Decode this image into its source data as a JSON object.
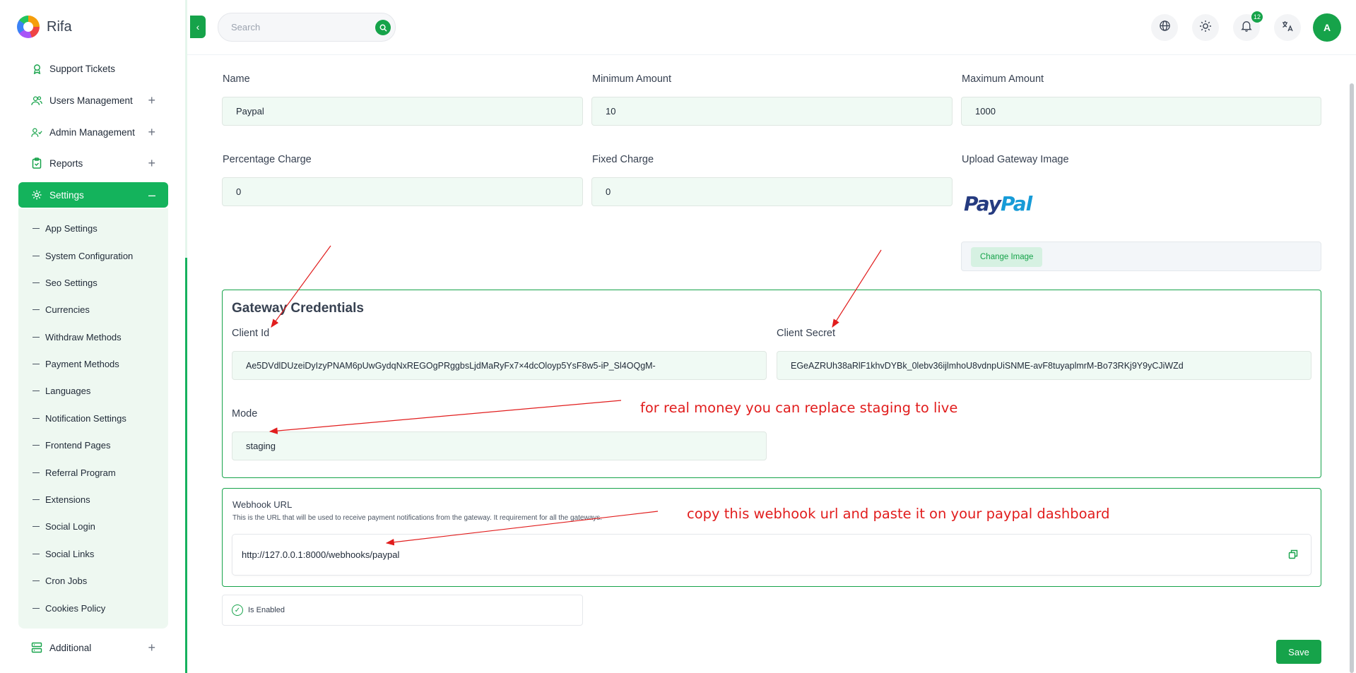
{
  "brand": {
    "name": "Rifa"
  },
  "header": {
    "search_placeholder": "Search",
    "notifications_count": "12",
    "avatar_initial": "A"
  },
  "sidebar": {
    "items": [
      {
        "label": "Support Tickets",
        "icon": "ticket-icon"
      },
      {
        "label": "Users Management",
        "icon": "users-icon"
      },
      {
        "label": "Admin Management",
        "icon": "admin-users-icon"
      },
      {
        "label": "Reports",
        "icon": "clipboard-icon"
      },
      {
        "label": "Settings",
        "icon": "gear-icon"
      },
      {
        "label": "Additional",
        "icon": "server-icon"
      }
    ],
    "settings_sub": [
      "App Settings",
      "System Configuration",
      "Seo Settings",
      "Currencies",
      "Withdraw Methods",
      "Payment Methods",
      "Languages",
      "Notification Settings",
      "Frontend Pages",
      "Referral Program",
      "Extensions",
      "Social Login",
      "Social Links",
      "Cron Jobs",
      "Cookies Policy"
    ]
  },
  "form": {
    "name_label": "Name",
    "name_value": "Paypal",
    "min_label": "Minimum Amount",
    "min_value": "10",
    "max_label": "Maximum Amount",
    "max_value": "1000",
    "pct_label": "Percentage Charge",
    "pct_value": "0",
    "fixed_label": "Fixed Charge",
    "fixed_value": "0",
    "upload_label": "Upload Gateway Image",
    "logo_text_1": "Pay",
    "logo_text_2": "Pal",
    "change_image": "Change Image"
  },
  "credentials": {
    "title": "Gateway Credentials",
    "client_id_label": "Client Id",
    "client_id_value": "Ae5DVdlDUzeiDyIzyPNAM6pUwGydqNxREGOgPRggbsLjdMaRyFx7×4dcOloyp5YsF8w5-iP_Sl4OQgM-",
    "client_secret_label": "Client Secret",
    "client_secret_value": "EGeAZRUh38aRlF1khvDYBk_0lebv36ijlmhoU8vdnpUiSNME-avF8tuyaplmrM-Bo73RKj9Y9yCJiWZd",
    "mode_label": "Mode",
    "mode_value": "staging"
  },
  "webhook": {
    "title": "Webhook URL",
    "description": "This is the URL that will be used to receive payment notifications from the gateway. It requirement for all the gateways.",
    "url": "http://127.0.0.1:8000/webhooks/paypal"
  },
  "enabled_label": "Is Enabled",
  "save_label": "Save",
  "annotations": {
    "mode_note": "for real money you can replace staging to live",
    "webhook_note": "copy this webhook url and paste it on your paypal dashboard"
  },
  "colors": {
    "accent": "#16a34a",
    "annotation": "#e11d1d"
  }
}
